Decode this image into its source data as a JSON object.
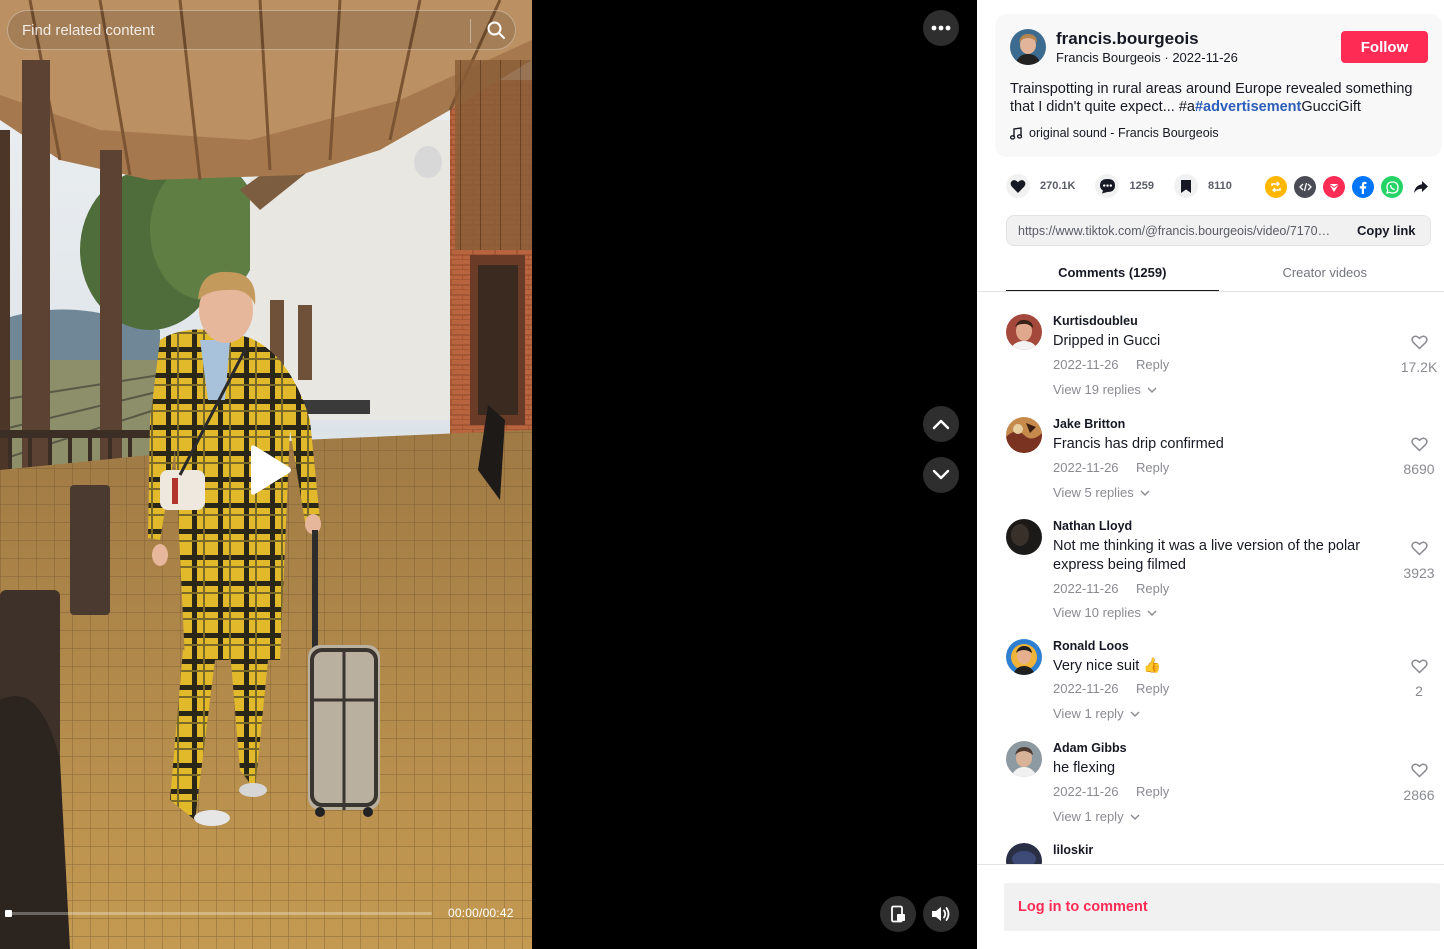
{
  "search": {
    "placeholder": "Find related content"
  },
  "player": {
    "time": "00:00/00:42",
    "progress": 0.0
  },
  "author": {
    "handle": "francis.bourgeois",
    "name": "Francis Bourgeois",
    "date": "2022-11-26",
    "meta": "Francis Bourgeois · 2022-11-26",
    "follow_label": "Follow"
  },
  "description": {
    "text_before": "Trainspotting in rural areas around Europe revealed something that I didn't quite expect... #a",
    "hashtag": "#advertisement",
    "text_after": "GucciGift"
  },
  "music": {
    "label": "original sound - Francis Bourgeois",
    "icon": "music-note-icon"
  },
  "stats": {
    "likes": "270.1K",
    "comments": "1259",
    "saves": "8110"
  },
  "share_icons": [
    "repost-icon",
    "embed-icon",
    "telegram-icon",
    "facebook-icon",
    "whatsapp-icon",
    "share-arrow-icon"
  ],
  "link": {
    "url": "https://www.tiktok.com/@francis.bourgeois/video/7170…",
    "copy_label": "Copy link"
  },
  "tabs": [
    {
      "label": "Comments (1259)",
      "active": true
    },
    {
      "label": "Creator videos",
      "active": false
    }
  ],
  "comments": [
    {
      "user": "Kurtisdoubleu",
      "text": "Dripped in Gucci",
      "date": "2022-11-26",
      "reply": "Reply",
      "view_replies": "View 19 replies",
      "likes": "17.2K"
    },
    {
      "user": "Jake Britton",
      "text": "Francis has drip confirmed",
      "date": "2022-11-26",
      "reply": "Reply",
      "view_replies": "View 5 replies",
      "likes": "8690"
    },
    {
      "user": "Nathan Lloyd",
      "text": "Not me thinking it was a live version of the polar express being filmed",
      "date": "2022-11-26",
      "reply": "Reply",
      "view_replies": "View 10 replies",
      "likes": "3923"
    },
    {
      "user": "Ronald Loos",
      "text": "Very nice suit 👍",
      "date": "2022-11-26",
      "reply": "Reply",
      "view_replies": "View 1 reply",
      "likes": "2"
    },
    {
      "user": "Adam Gibbs",
      "text": "he flexing",
      "date": "2022-11-26",
      "reply": "Reply",
      "view_replies": "View 1 reply",
      "likes": "2866"
    },
    {
      "user": "liloskir",
      "text": "",
      "date": "",
      "reply": "",
      "view_replies": "",
      "likes": ""
    }
  ],
  "login": {
    "label": "Log in to comment"
  },
  "colors": {
    "accent": "#fe2c55",
    "hashtag": "#2b5db9",
    "muted": "#8a8b91"
  }
}
